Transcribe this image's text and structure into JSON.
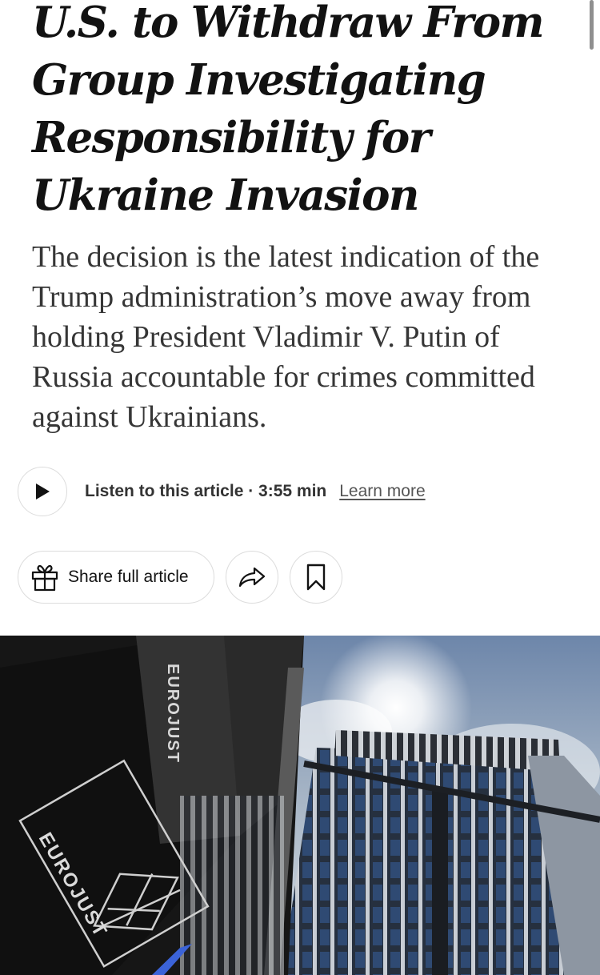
{
  "article": {
    "headline": "U.S. to Withdraw From Group Investigating Responsibility for Ukraine Invasion",
    "summary": "The decision is the latest indication of the Trump administration’s move away from holding President Vladimir V. Putin of Russia accountable for crimes committed against Ukrainians."
  },
  "audio": {
    "listen_label": "Listen to this article · 3:55 min",
    "learn_more": "Learn more",
    "play_icon": "play-icon"
  },
  "actions": {
    "share_full_label": "Share full article",
    "gift_icon": "gift-icon",
    "share_icon": "share-arrow-icon",
    "bookmark_icon": "bookmark-icon"
  },
  "photo": {
    "sign_text_vertical": "EUROJUST",
    "sign_text_logo": "EUROJUST"
  },
  "colors": {
    "text": "#121212",
    "summary": "#363636",
    "border": "#dcdcdc"
  }
}
